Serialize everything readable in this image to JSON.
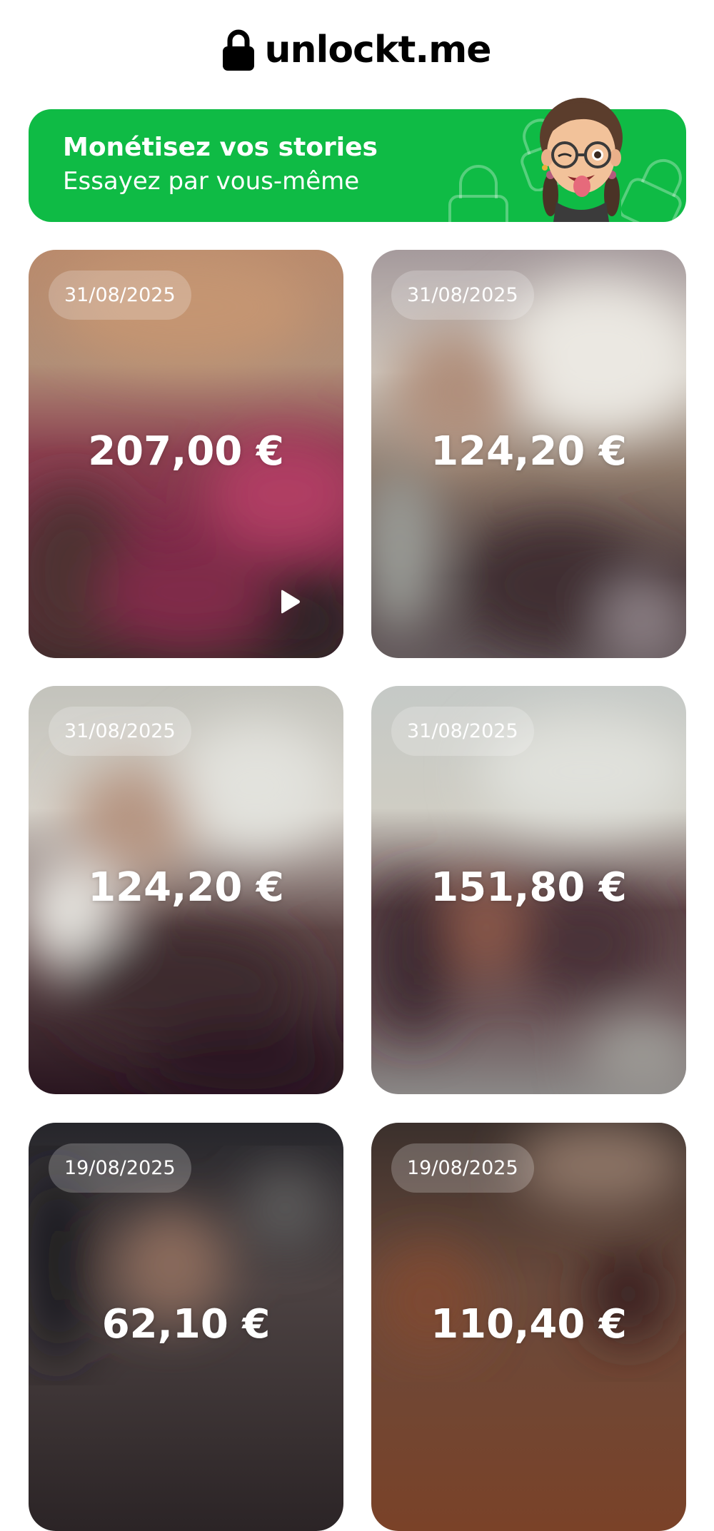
{
  "header": {
    "brand": "unlockt.me",
    "logo_icon": "lock-icon"
  },
  "banner": {
    "title": "Monétisez vos stories",
    "subtitle": "Essayez par vous-même",
    "background_color": "#0fbb45",
    "avatar_icon": "memoji-avatar-icon"
  },
  "stories": [
    {
      "date": "31/08/2025",
      "price": "207,00 €",
      "has_video": true
    },
    {
      "date": "31/08/2025",
      "price": "124,20 €",
      "has_video": false
    },
    {
      "date": "31/08/2025",
      "price": "124,20 €",
      "has_video": false
    },
    {
      "date": "31/08/2025",
      "price": "151,80 €",
      "has_video": false
    },
    {
      "date": "19/08/2025",
      "price": "62,10 €",
      "has_video": false
    },
    {
      "date": "19/08/2025",
      "price": "110,40 €",
      "has_video": false
    }
  ]
}
